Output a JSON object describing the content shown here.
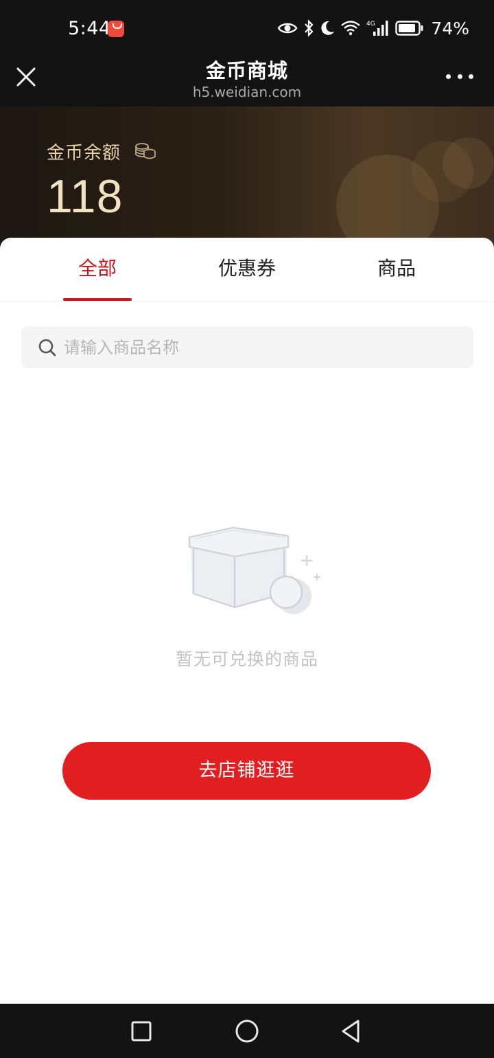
{
  "status_bar": {
    "time": "5:44",
    "battery_percent": "74%",
    "network": "4G",
    "icons": [
      "app-badge-icon",
      "eye-icon",
      "bluetooth-icon",
      "moon-icon",
      "wifi-icon",
      "signal-icon",
      "battery-icon"
    ]
  },
  "title_bar": {
    "title": "金币商城",
    "url": "h5.weidian.com"
  },
  "balance": {
    "label": "金币余额",
    "amount": "118"
  },
  "tabs": [
    {
      "label": "全部",
      "active": true
    },
    {
      "label": "优惠券",
      "active": false
    },
    {
      "label": "商品",
      "active": false
    }
  ],
  "search": {
    "placeholder": "请输入商品名称",
    "value": ""
  },
  "empty_state": {
    "message": "暂无可兑换的商品",
    "icon": "empty-box-icon"
  },
  "cta": {
    "label": "去店铺逛逛"
  },
  "colors": {
    "accent": "#c8161d",
    "button": "#e11f21",
    "gold_text": "#e9d3a8"
  }
}
